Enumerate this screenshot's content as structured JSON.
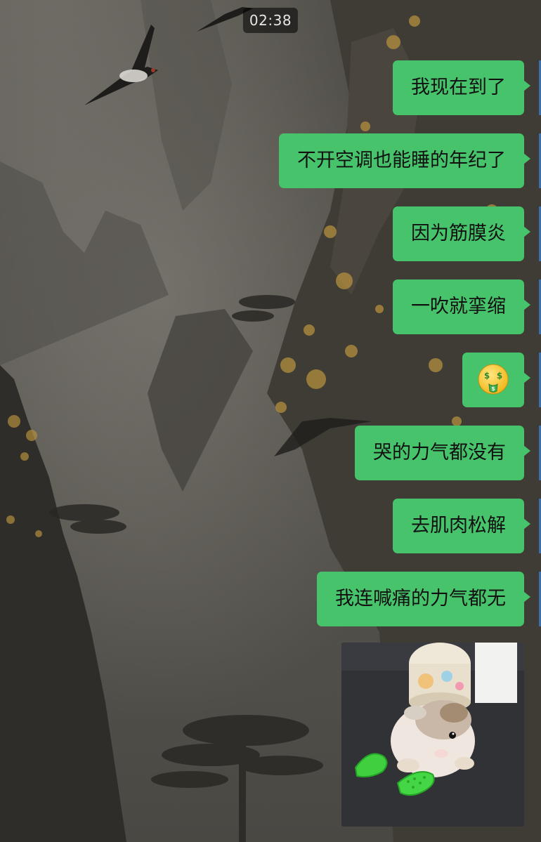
{
  "status": {
    "time": "02:38"
  },
  "messages": [
    {
      "type": "text",
      "side": "right",
      "text": "我现在到了"
    },
    {
      "type": "text",
      "side": "right",
      "text": "不开空调也能睡的年纪了"
    },
    {
      "type": "text",
      "side": "right",
      "text": "因为筋膜炎"
    },
    {
      "type": "text",
      "side": "right",
      "text": "一吹就挛缩"
    },
    {
      "type": "emoji",
      "side": "right",
      "emoji": "money-mouth-face-emoji"
    },
    {
      "type": "text",
      "side": "right",
      "text": "哭的力气都没有"
    },
    {
      "type": "text",
      "side": "right",
      "text": "去肌肉松解"
    },
    {
      "type": "text",
      "side": "right",
      "text": "我连喊痛的力气都无"
    },
    {
      "type": "image",
      "side": "right",
      "subject": "hamster-with-tiny-green-shoes"
    }
  ],
  "theme": {
    "bubble_color": "#47c36b",
    "timestamp_bg": "rgba(0,0,0,0.55)",
    "background_style": "ink-painting-mountains-with-swallows"
  }
}
